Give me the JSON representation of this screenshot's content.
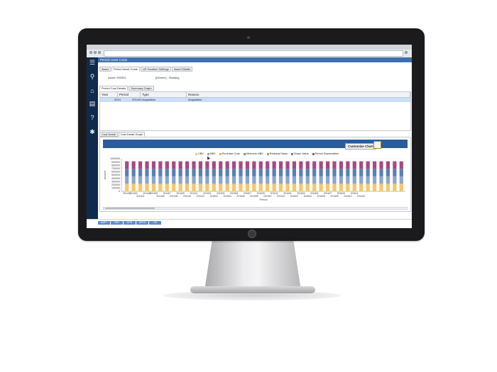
{
  "app": {
    "title": "Period Asset Costs",
    "main_tabs": [
      "Asset",
      "Period Asset Costs",
      "US Taxation Settings",
      "Asset Details"
    ],
    "active_main_tab": 1,
    "asset_label": "Asset: 000001",
    "asset_desc": "(Almeric) - Building",
    "cost_tabs": [
      "Period Cost Details",
      "Summary Graph"
    ],
    "grid": {
      "columns": [
        "Year",
        "Period",
        "Type",
        "Reason"
      ],
      "rows": [
        {
          "year": "2014",
          "period": "201401",
          "type": "Acquisition",
          "reason": "Acquisition"
        }
      ]
    },
    "detail_tabs": [
      "Cost Detail",
      "Cost Detail Graph"
    ],
    "customize_label": "Customize Chart",
    "bottom_tabs": [
      "AMFT",
      "FAR",
      "ACR",
      "ARTS",
      "CE"
    ]
  },
  "chart_data": {
    "type": "bar",
    "stacked": true,
    "xlabel": "Period",
    "ylabel": "Amount",
    "ylim": [
      0,
      1000000
    ],
    "yticks": [
      0,
      100000,
      200000,
      300000,
      400000,
      500000,
      600000,
      700000,
      800000,
      900000,
      1000000
    ],
    "legend": [
      {
        "name": "CBV",
        "color": "#f7c766"
      },
      {
        "name": "NBV",
        "color": "#8ba6cf"
      },
      {
        "name": "Purchase Cost",
        "color": "#e9b15a"
      },
      {
        "name": "Minimum NBV",
        "color": "#7aa36a"
      },
      {
        "name": "Residual Value",
        "color": "#d98c4a"
      },
      {
        "name": "Share Value",
        "color": "#5a7fb5"
      },
      {
        "name": "Period Depreciation",
        "color": "#a64a7e"
      }
    ],
    "categories": [
      "201401",
      "201402",
      "201403",
      "201404",
      "201405",
      "201406",
      "201407",
      "201408",
      "201409",
      "201410",
      "201411",
      "201412",
      "201501",
      "201502",
      "201503",
      "201504",
      "201505",
      "201506",
      "201507",
      "201508",
      "201509",
      "201510",
      "201511",
      "201512",
      "201601",
      "201602",
      "201603",
      "201604",
      "201605",
      "201606",
      "201607",
      "201608",
      "201609",
      "201610",
      "201611",
      "201612",
      "201701",
      "201702",
      "201703",
      "201704",
      "201705",
      "201706"
    ],
    "tick_labels_top": [
      "201401",
      "201402",
      "201404",
      "201405",
      "201407",
      "201409",
      "201411",
      "201501",
      "201503",
      "201505",
      "201507",
      "201509",
      "201511",
      "201601",
      "201603",
      "201605",
      "201607",
      "201609",
      "201611"
    ],
    "tick_labels_bottom": [
      "201403",
      "201406",
      "201408",
      "201410",
      "201412",
      "201502",
      "201504",
      "201506",
      "201508",
      "201510",
      "201512",
      "201602",
      "201604",
      "201606",
      "201608",
      "201610",
      "201612"
    ],
    "series": [
      {
        "name": "CBV",
        "values": [
          230000,
          230000,
          230000,
          230000,
          230000,
          230000,
          230000,
          230000,
          230000,
          230000,
          230000,
          230000,
          230000,
          230000,
          230000,
          230000,
          230000,
          230000,
          230000,
          230000,
          230000,
          230000,
          230000,
          230000,
          230000,
          230000,
          230000,
          230000,
          230000,
          230000,
          230000,
          230000,
          230000,
          230000,
          230000,
          230000,
          230000,
          230000,
          230000,
          230000,
          230000,
          230000
        ]
      },
      {
        "name": "NBV",
        "values": [
          230000,
          230000,
          230000,
          230000,
          230000,
          230000,
          230000,
          230000,
          230000,
          230000,
          230000,
          230000,
          230000,
          230000,
          230000,
          230000,
          230000,
          230000,
          230000,
          230000,
          230000,
          230000,
          230000,
          230000,
          230000,
          230000,
          230000,
          230000,
          230000,
          230000,
          230000,
          230000,
          230000,
          230000,
          230000,
          230000,
          230000,
          230000,
          230000,
          230000,
          230000,
          230000
        ]
      },
      {
        "name": "Share Value",
        "values": [
          230000,
          230000,
          230000,
          230000,
          230000,
          230000,
          230000,
          230000,
          230000,
          230000,
          230000,
          230000,
          230000,
          230000,
          230000,
          230000,
          230000,
          230000,
          230000,
          230000,
          230000,
          230000,
          230000,
          230000,
          230000,
          230000,
          230000,
          230000,
          230000,
          230000,
          230000,
          230000,
          230000,
          230000,
          230000,
          230000,
          230000,
          230000,
          230000,
          230000,
          230000,
          230000
        ]
      },
      {
        "name": "Period Depreciation",
        "values": [
          230000,
          230000,
          230000,
          230000,
          230000,
          230000,
          230000,
          230000,
          230000,
          230000,
          230000,
          230000,
          230000,
          230000,
          230000,
          230000,
          230000,
          230000,
          230000,
          230000,
          230000,
          230000,
          230000,
          230000,
          230000,
          230000,
          230000,
          230000,
          230000,
          230000,
          230000,
          230000,
          230000,
          230000,
          230000,
          230000,
          230000,
          230000,
          230000,
          230000,
          230000,
          230000
        ]
      }
    ]
  }
}
